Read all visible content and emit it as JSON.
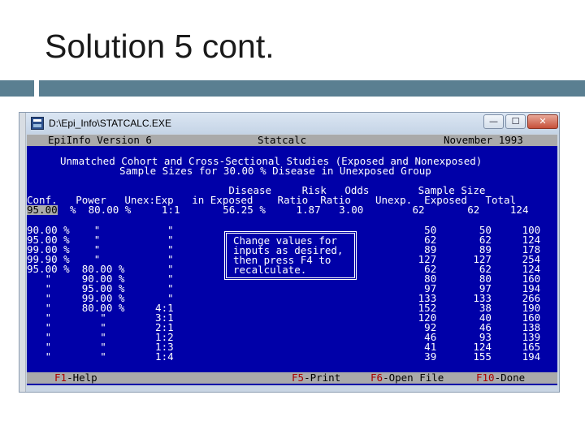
{
  "slide": {
    "title": "Solution 5 cont."
  },
  "window": {
    "title": "D:\\Epi_Info\\STATCALC.EXE",
    "min_glyph": "—",
    "max_glyph": "☐",
    "close_glyph": "✕"
  },
  "dos": {
    "header": {
      "left": "EpiInfo Version 6",
      "center": "Statcalc",
      "right": "November 1993"
    },
    "heading_line1": "Unmatched Cohort and Cross-Sectional Studies (Exposed and Nonexposed)",
    "heading_line2": "Sample Sizes for 30.00 % Disease in Unexposed Group",
    "col_header1": "                                 Disease     Risk   Odds        Sample Size",
    "col_header2_a": "Conf.   Power   Unex:Exp   in Exposed    Ratio  Ratio    Unexp.  Exposed   Total",
    "input_conf": "95.00",
    "input_rest": "  %  80.00 %     1:1       56.25 %     1.87   3.00        62       62     124",
    "rows": [
      "90.00 %    \"           \"                                         50       50     100",
      "95.00 %    \"           \"                                         62       62     124",
      "99.00 %    \"           \"                                         89       89     178",
      "99.90 %    \"           \"                                        127      127     254",
      "95.00 %  80.00 %       \"                                         62       62     124",
      "   \"     90.00 %       \"                                         80       80     160",
      "   \"     95.00 %       \"                                         97       97     194",
      "   \"     99.00 %       \"                                        133      133     266",
      "   \"     80.00 %     4:1                                        152       38     190",
      "   \"        \"        3:1                                        120       40     160",
      "   \"        \"        2:1                                         92       46     138",
      "   \"        \"        1:2                                         46       93     139",
      "   \"        \"        1:3                                         41      124     165",
      "   \"        \"        1:4                                         39      155     194"
    ],
    "message": [
      "Change values for",
      "inputs as desired,",
      "then press F4 to",
      "recalculate."
    ],
    "footer": {
      "f1_key": "F1",
      "f1_label": "-Help",
      "f5_key": "F5",
      "f5_label": "-Print",
      "f6_key": "F6",
      "f6_label": "-Open File",
      "f10_key": "F10",
      "f10_label": "-Done"
    }
  }
}
